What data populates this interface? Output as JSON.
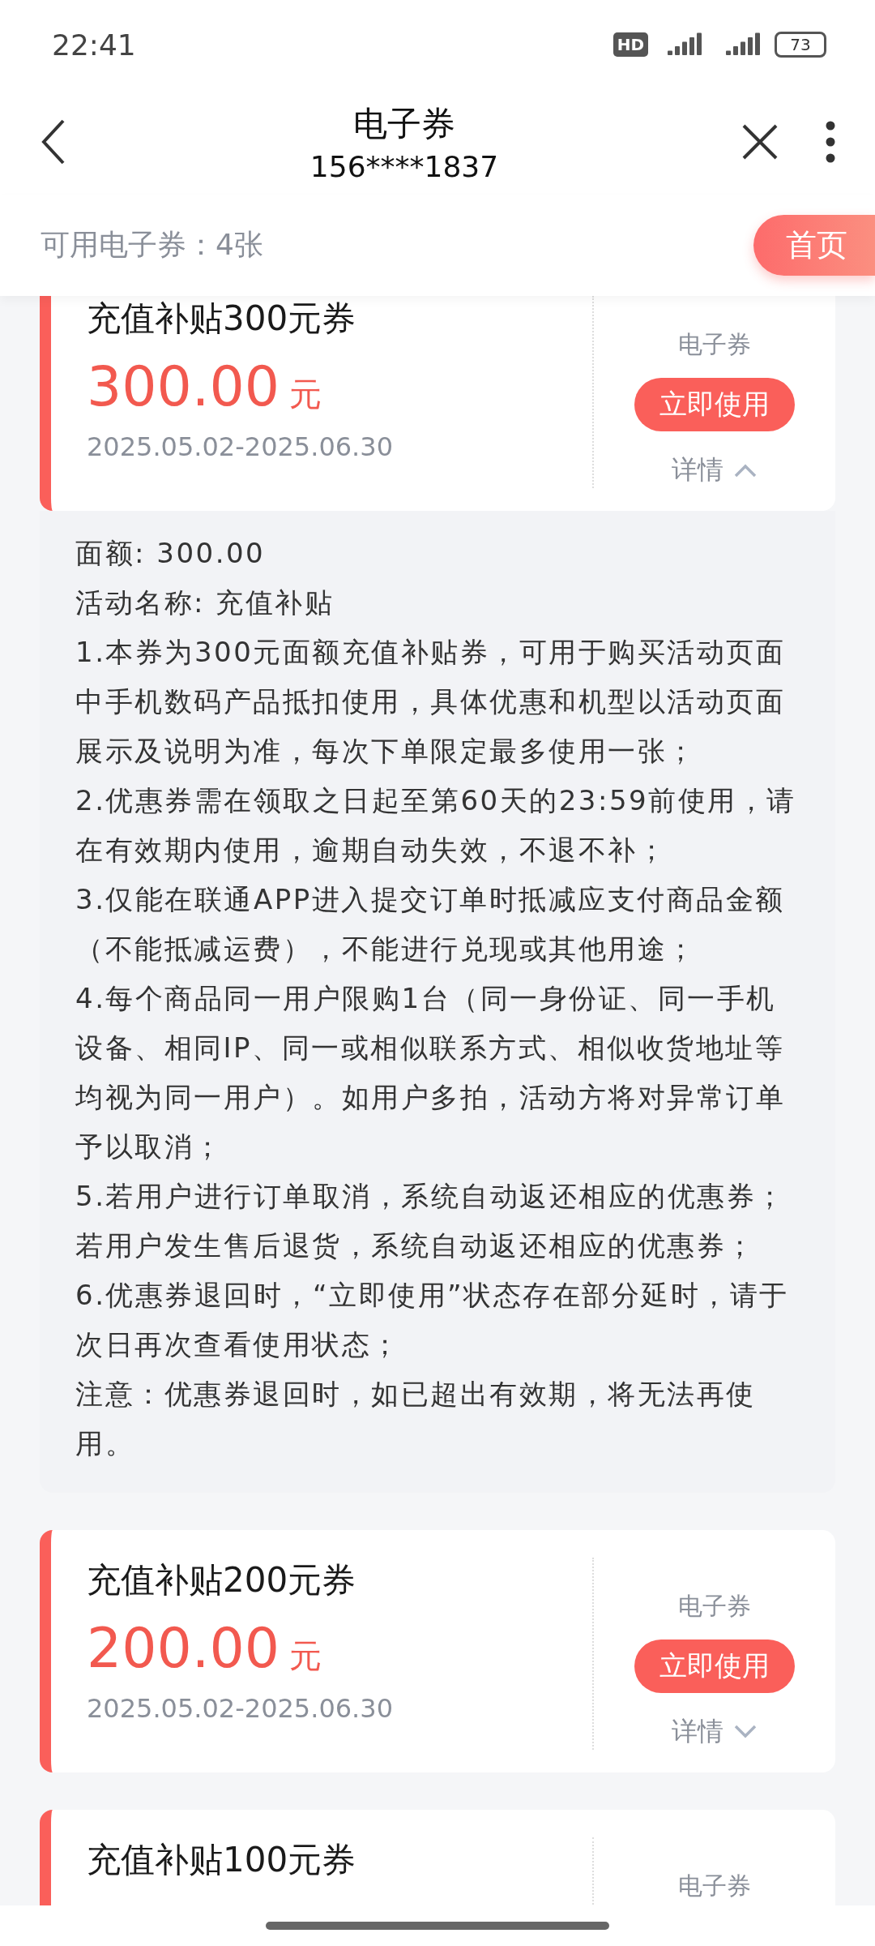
{
  "status_bar": {
    "time": "22:41",
    "hd_badge": "HD",
    "battery": "73"
  },
  "header": {
    "title": "电子券",
    "subtitle": "156****1837"
  },
  "summary": {
    "text": "可用电子券：4张",
    "home_button": "首页"
  },
  "coupons": [
    {
      "kind": "full",
      "title": "充值补贴300元券",
      "amount": "300.00",
      "unit": "元",
      "dates": "2025.05.02-2025.06.30",
      "type_label": "电子券",
      "use_button": "立即使用",
      "details_link": "详情",
      "expanded": true,
      "details": [
        "面额: 300.00",
        "活动名称: 充值补贴",
        "1.本券为300元面额充值补贴券，可用于购买活动页面中手机数码产品抵扣使用，具体优惠和机型以活动页面展示及说明为准，每次下单限定最多使用一张；",
        "2.优惠券需在领取之日起至第60天的23:59前使用，请在有效期内使用，逾期自动失效，不退不补；",
        "3.仅能在联通APP进入提交订单时抵减应支付商品金额（不能抵减运费），不能进行兑现或其他用途；",
        "4.每个商品同一用户限购1台（同一身份证、同一手机设备、相同IP、同一或相似联系方式、相似收货地址等均视为同一用户）。如用户多拍，活动方将对异常订单予以取消；",
        "5.若用户进行订单取消，系统自动返还相应的优惠券；若用户发生售后退货，系统自动返还相应的优惠券；",
        "6.优惠券退回时，“立即使用”状态存在部分延时，请于次日再次查看使用状态；",
        "注意：优惠券退回时，如已超出有效期，将无法再使用。"
      ]
    },
    {
      "kind": "full",
      "title": "充值补贴200元券",
      "amount": "200.00",
      "unit": "元",
      "dates": "2025.05.02-2025.06.30",
      "type_label": "电子券",
      "use_button": "立即使用",
      "details_link": "详情",
      "expanded": false
    },
    {
      "kind": "partial",
      "title": "充值补贴100元券",
      "type_label": "电子券"
    }
  ]
}
